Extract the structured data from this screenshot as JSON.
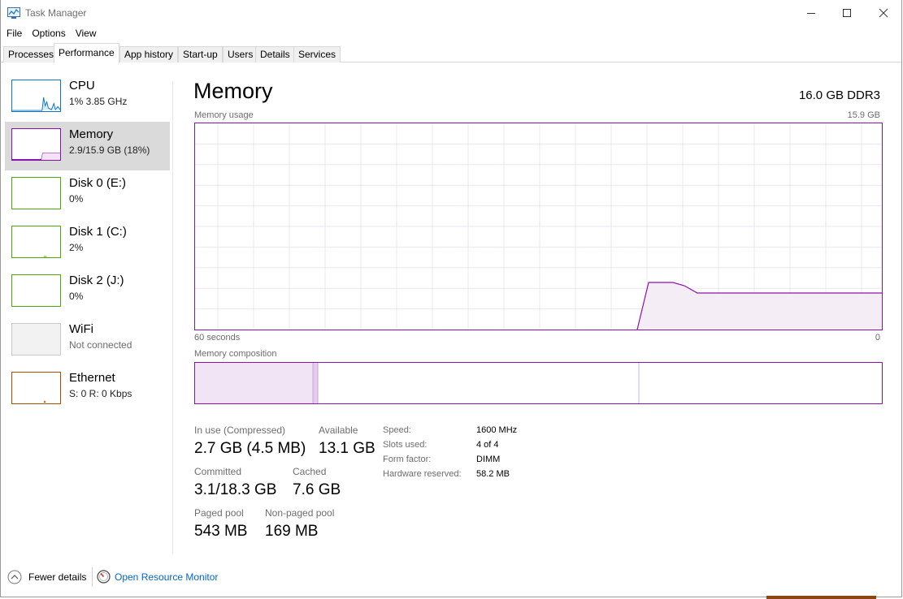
{
  "window": {
    "title": "Task Manager",
    "app_icon": "task-manager-icon"
  },
  "menu": [
    "File",
    "Options",
    "View"
  ],
  "tabs": [
    {
      "label": "Processes",
      "active": false
    },
    {
      "label": "Performance",
      "active": true
    },
    {
      "label": "App history",
      "active": false
    },
    {
      "label": "Start-up",
      "active": false
    },
    {
      "label": "Users",
      "active": false
    },
    {
      "label": "Details",
      "active": false
    },
    {
      "label": "Services",
      "active": false
    }
  ],
  "sidebar": {
    "items": [
      {
        "title": "CPU",
        "sub": "1% 3.85 GHz",
        "color": "#1176c1"
      },
      {
        "title": "Memory",
        "sub": "2.9/15.9 GB (18%)",
        "color": "#8b12ae",
        "selected": true
      },
      {
        "title": "Disk 0 (E:)",
        "sub": "0%",
        "color": "#4da60c"
      },
      {
        "title": "Disk 1 (C:)",
        "sub": "2%",
        "color": "#4da60c"
      },
      {
        "title": "Disk 2 (J:)",
        "sub": "0%",
        "color": "#4da60c"
      },
      {
        "title": "WiFi",
        "sub": "Not connected",
        "color": "#c8c8c8"
      },
      {
        "title": "Ethernet",
        "sub": "S: 0 R: 0 Kbps",
        "color": "#a74f01"
      }
    ]
  },
  "main": {
    "title": "Memory",
    "spec": "16.0 GB DDR3",
    "usage_label": "Memory usage",
    "usage_max": "15.9 GB",
    "time_left": "60 seconds",
    "time_right": "0",
    "composition_label": "Memory composition",
    "accent": "#8b12ae"
  },
  "stats": {
    "in_use_label": "In use (Compressed)",
    "in_use_value": "2.7 GB (4.5 MB)",
    "available_label": "Available",
    "available_value": "13.1 GB",
    "committed_label": "Committed",
    "committed_value": "3.1/18.3 GB",
    "cached_label": "Cached",
    "cached_value": "7.6 GB",
    "paged_label": "Paged pool",
    "paged_value": "543 MB",
    "nonpaged_label": "Non-paged pool",
    "nonpaged_value": "169 MB"
  },
  "specs": {
    "speed_label": "Speed:",
    "speed_value": "1600 MHz",
    "slots_label": "Slots used:",
    "slots_value": "4 of 4",
    "form_label": "Form factor:",
    "form_value": "DIMM",
    "hw_label": "Hardware reserved:",
    "hw_value": "58.2 MB"
  },
  "footer": {
    "fewer_details": "Fewer details",
    "open_resource_monitor": "Open Resource Monitor"
  }
}
